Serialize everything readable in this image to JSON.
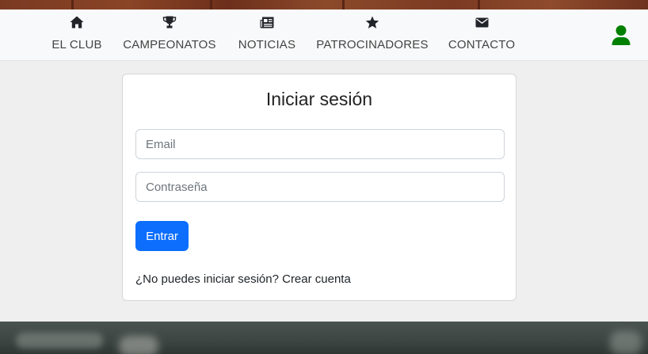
{
  "nav": {
    "items": [
      {
        "label": "EL CLUB",
        "icon": "home-icon"
      },
      {
        "label": "CAMPEONATOS",
        "icon": "trophy-icon"
      },
      {
        "label": "NOTICIAS",
        "icon": "newspaper-icon"
      },
      {
        "label": "PATROCINADORES",
        "icon": "star-icon"
      },
      {
        "label": "CONTACTO",
        "icon": "envelope-icon"
      }
    ],
    "user_icon": "user-icon",
    "user_color": "#008000"
  },
  "login": {
    "title": "Iniciar sesión",
    "email_placeholder": "Email",
    "email_value": "",
    "password_placeholder": "Contraseña",
    "password_value": "",
    "submit_label": "Entrar",
    "footer_text": "¿No puedes iniciar sesión?",
    "create_account_label": "Crear cuenta"
  },
  "colors": {
    "primary": "#0d6efd",
    "navbar_bg": "#f8f9fa",
    "page_bg": "#efefef"
  }
}
